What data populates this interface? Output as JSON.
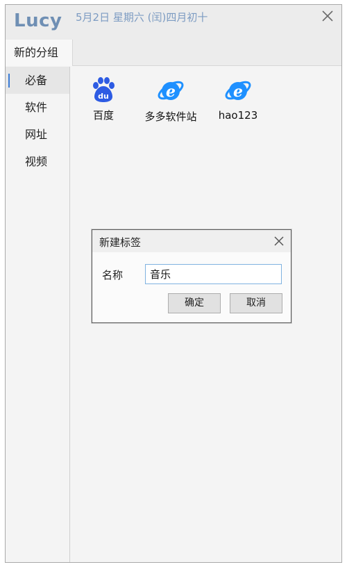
{
  "header": {
    "app_name": "Lucy",
    "date_text": "5月2日 星期六 (闰)四月初十"
  },
  "tabs": [
    {
      "label": "新的分组",
      "active": true
    }
  ],
  "sidebar": {
    "items": [
      {
        "label": "必备",
        "active": true
      },
      {
        "label": "软件"
      },
      {
        "label": "网址"
      },
      {
        "label": "视频"
      }
    ]
  },
  "apps": [
    {
      "label": "百度",
      "icon": "baidu-paw-icon"
    },
    {
      "label": "多多软件站",
      "icon": "ie-icon"
    },
    {
      "label": "hao123",
      "icon": "ie-icon"
    }
  ],
  "dialog": {
    "title": "新建标签",
    "name_label": "名称",
    "name_value": "音乐",
    "confirm_label": "确定",
    "cancel_label": "取消"
  },
  "colors": {
    "accent": "#3a7bd5",
    "brand": "#6f8fb4",
    "ie_blue": "#1e90ff",
    "baidu_blue": "#2d5be3"
  }
}
